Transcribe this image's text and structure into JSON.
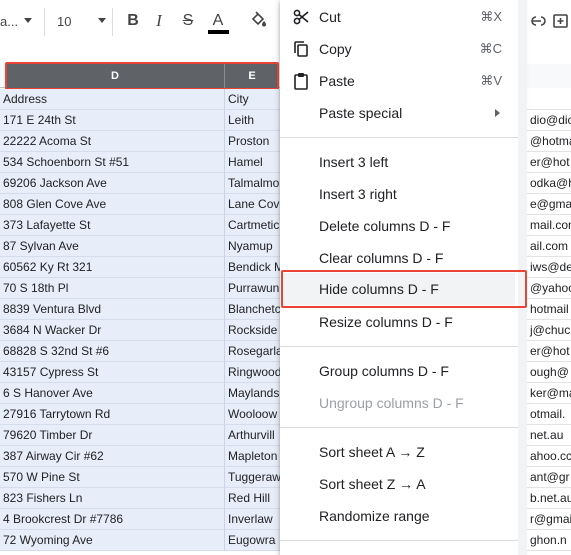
{
  "toolbar": {
    "font_name": "a...",
    "font_size": "10",
    "bold": "B",
    "italic": "I",
    "strike": "S",
    "text_color": "A",
    "text_color_hex": "#000000"
  },
  "columns": {
    "d": "D",
    "e": "E"
  },
  "colors": {
    "selection_header": "#5f6368",
    "selection_fill": "#e8eef9",
    "highlight": "#ea4335"
  },
  "rows": [
    {
      "d": "Address",
      "e": "City",
      "r": ""
    },
    {
      "d": "171 E 24th St",
      "e": "Leith",
      "r": "dio@dic"
    },
    {
      "d": "22222 Acoma St",
      "e": "Proston",
      "r": "@hotma"
    },
    {
      "d": "534 Schoenborn St #51",
      "e": "Hamel",
      "r": "er@hot"
    },
    {
      "d": "69206 Jackson Ave",
      "e": "Talmalmo",
      "r": "odka@h"
    },
    {
      "d": "808 Glen Cove Ave",
      "e": "Lane Cove",
      "r": "e@gmail"
    },
    {
      "d": "373 Lafayette St",
      "e": "Cartmetic",
      "r": "mail.com"
    },
    {
      "d": "87 Sylvan Ave",
      "e": "Nyamup",
      "r": "ail.com"
    },
    {
      "d": "60562 Ky Rt 321",
      "e": "Bendick M",
      "r": "iws@de"
    },
    {
      "d": "70 S 18th Pl",
      "e": "Purrawun",
      "r": "@yahoo"
    },
    {
      "d": "8839 Ventura Blvd",
      "e": "Blanchetc",
      "r": "hotmail"
    },
    {
      "d": "3684 N Wacker Dr",
      "e": "Rockside",
      "r": "j@chuc"
    },
    {
      "d": "68828 S 32nd St #6",
      "e": "Rosegarla",
      "r": "er@hot"
    },
    {
      "d": "43157 Cypress St",
      "e": "Ringwood",
      "r": "ough@"
    },
    {
      "d": "6 S Hanover Ave",
      "e": "Maylands",
      "r": "ker@ma"
    },
    {
      "d": "27916 Tarrytown Rd",
      "e": "Wooloow",
      "r": "otmail."
    },
    {
      "d": "79620 Timber Dr",
      "e": "Arthurvill",
      "r": "net.au"
    },
    {
      "d": "387 Airway Cir #62",
      "e": "Mapleton",
      "r": "ahoo.cc"
    },
    {
      "d": "570 W Pine St",
      "e": "Tuggeraw",
      "r": "ant@gr"
    },
    {
      "d": "823 Fishers Ln",
      "e": "Red Hill",
      "r": "b.net.au"
    },
    {
      "d": "4 Brookcrest Dr #7786",
      "e": "Inverlaw",
      "r": "r@gmai"
    },
    {
      "d": "72 Wyoming Ave",
      "e": "Eugowra",
      "r": "ghon.n"
    }
  ],
  "menu": {
    "cut": {
      "label": "Cut",
      "shortcut": "⌘X"
    },
    "copy": {
      "label": "Copy",
      "shortcut": "⌘C"
    },
    "paste": {
      "label": "Paste",
      "shortcut": "⌘V"
    },
    "paste_special": {
      "label": "Paste special"
    },
    "insert_left": {
      "label": "Insert 3 left"
    },
    "insert_right": {
      "label": "Insert 3 right"
    },
    "delete_columns": {
      "label": "Delete columns D - F"
    },
    "clear_columns": {
      "label": "Clear columns D - F"
    },
    "hide_columns": {
      "label": "Hide columns D - F"
    },
    "resize_columns": {
      "label": "Resize columns D - F"
    },
    "group_columns": {
      "label": "Group columns D - F"
    },
    "ungroup_columns": {
      "label": "Ungroup columns D - F"
    },
    "sort_az": {
      "label": "Sort sheet A → Z"
    },
    "sort_za": {
      "label": "Sort sheet Z → A"
    },
    "randomize": {
      "label": "Randomize range"
    }
  }
}
